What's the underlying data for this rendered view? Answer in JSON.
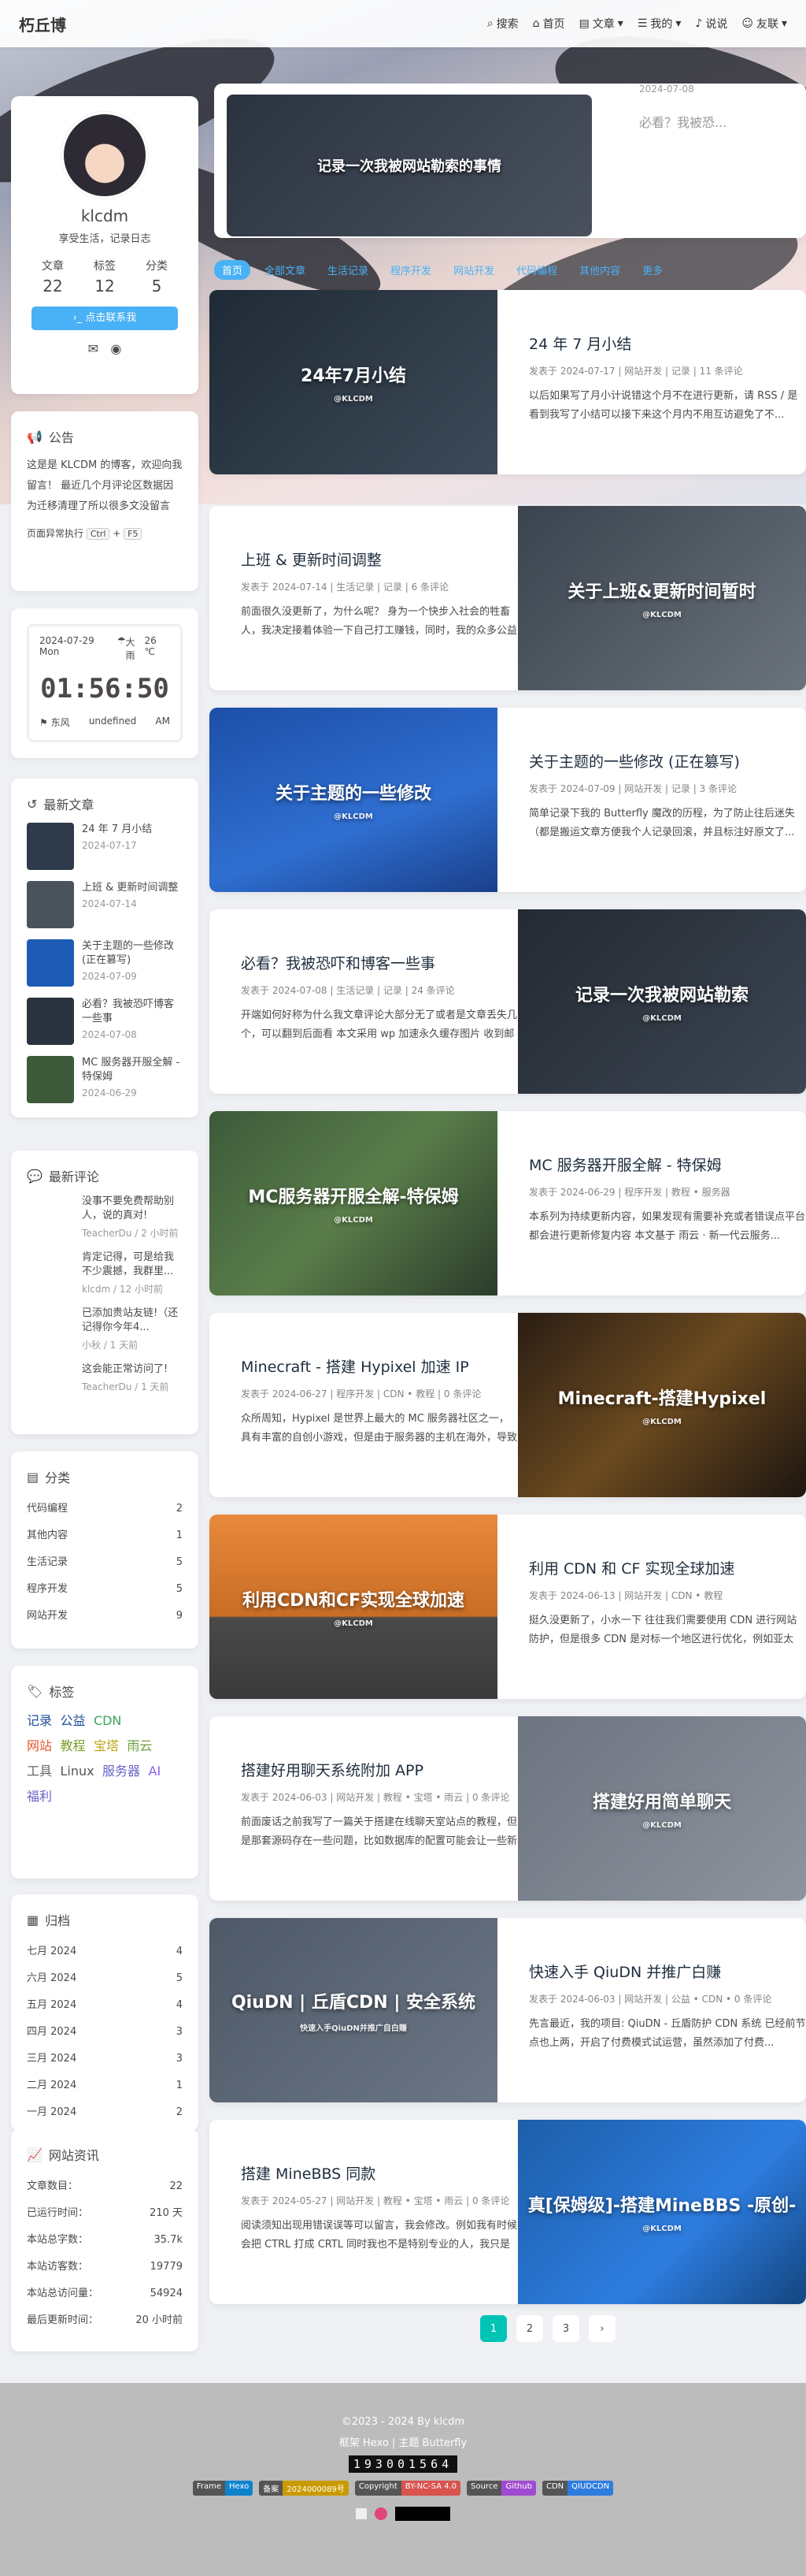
{
  "nav": {
    "brand": "朽丘博",
    "items": [
      "搜索",
      "首页",
      "文章",
      "我的",
      "说说",
      "友联"
    ]
  },
  "featured": {
    "image_title": "记录一次我被网站勒索的事情",
    "date": "2024-07-08",
    "title": "必看？我被恐..."
  },
  "profile": {
    "name": "klcdm",
    "bio": "享受生活，记录日志",
    "stats": [
      {
        "label": "文章",
        "value": "22"
      },
      {
        "label": "标签",
        "value": "12"
      },
      {
        "label": "分类",
        "value": "5"
      }
    ],
    "follow": "点击联系我"
  },
  "announcement": {
    "title": "公告",
    "text": "这是是 KLCDM 的博客，欢迎向我留言！ 最近几个月评论区数据因为迁移清理了所以很多文没留言",
    "shortcut_text": "页面异常执行",
    "key1": "Ctrl",
    "plus": "+",
    "key2": "F5"
  },
  "weather": {
    "date": "2024-07-29 Mon",
    "weather": "大雨",
    "temp": "26 ℃",
    "time": "01:56:50",
    "wind": "东风",
    "extra": "undefined",
    "ampm": "AM"
  },
  "recent": {
    "title": "最新文章",
    "items": [
      {
        "title": "24 年 7 月小结",
        "date": "2024-07-17"
      },
      {
        "title": "上班 & 更新时间调整",
        "date": "2024-07-14"
      },
      {
        "title": "关于主题的一些修改 (正在篡写)",
        "date": "2024-07-09"
      },
      {
        "title": "必看？我被恐吓博客一些事",
        "date": "2024-07-08"
      },
      {
        "title": "MC 服务器开服全解 - 特保姆",
        "date": "2024-06-29"
      }
    ]
  },
  "comments": {
    "title": "最新评论",
    "items": [
      {
        "text": "没事不要免费帮助别人，说的真对!",
        "by": "TeacherDu / 2 小时前"
      },
      {
        "text": "肯定记得，可是给我不少震撼，我群里...",
        "by": "klcdm / 12 小时前"
      },
      {
        "text": "已添加贵站友链!（还记得你今年4...",
        "by": "小秋 / 1 天前"
      },
      {
        "text": "这会能正常访问了!",
        "by": "TeacherDu / 1 天前"
      }
    ]
  },
  "categories": {
    "title": "分类",
    "items": [
      {
        "name": "代码编程",
        "count": "2"
      },
      {
        "name": "其他内容",
        "count": "1"
      },
      {
        "name": "生活记录",
        "count": "5"
      },
      {
        "name": "程序开发",
        "count": "5"
      },
      {
        "name": "网站开发",
        "count": "9"
      }
    ]
  },
  "tags": {
    "title": "标签",
    "items": [
      {
        "name": "记录",
        "color": "#1f4e99"
      },
      {
        "name": "公益",
        "color": "#1f4e99"
      },
      {
        "name": "CDN",
        "color": "#3aa55d"
      },
      {
        "name": "网站",
        "color": "#e0582b"
      },
      {
        "name": "教程",
        "color": "#7f9c2a"
      },
      {
        "name": "宝塔",
        "color": "#c2a319"
      },
      {
        "name": "雨云",
        "color": "#6c9e3a"
      },
      {
        "name": "工具",
        "color": "#666"
      },
      {
        "name": "Linux",
        "color": "#555"
      },
      {
        "name": "服务器",
        "color": "#6a64c9"
      },
      {
        "name": "AI",
        "color": "#8b5cf6"
      },
      {
        "name": "福利",
        "color": "#6a64c9"
      }
    ]
  },
  "archive": {
    "title": "归档",
    "items": [
      {
        "name": "七月 2024",
        "count": "4"
      },
      {
        "name": "六月 2024",
        "count": "5"
      },
      {
        "name": "五月 2024",
        "count": "4"
      },
      {
        "name": "四月 2024",
        "count": "3"
      },
      {
        "name": "三月 2024",
        "count": "3"
      },
      {
        "name": "二月 2024",
        "count": "1"
      },
      {
        "name": "一月 2024",
        "count": "2"
      }
    ]
  },
  "siteinfo": {
    "title": "网站资讯",
    "items": [
      {
        "name": "文章数目：",
        "value": "22"
      },
      {
        "name": "已运行时间：",
        "value": "210 天"
      },
      {
        "name": "本站总字数：",
        "value": "35.7k"
      },
      {
        "name": "本站访客数：",
        "value": "19779"
      },
      {
        "name": "本站总访问量：",
        "value": "54924"
      },
      {
        "name": "最后更新时间：",
        "value": "20 小时前"
      }
    ]
  },
  "tabs": [
    "首页",
    "全部文章",
    "生活记录",
    "程序开发",
    "网站开发",
    "代码编程",
    "其他内容",
    "更多"
  ],
  "posts": [
    {
      "img": "24年7月小结",
      "sub": "@KLCDM",
      "title": "24 年 7 月小结",
      "meta": "发表于 2024-07-17 | 网站开发 | 记录 | 11 条评论",
      "excerpt": "以后如果写了月小计说错这个月不在进行更新，请 RSS / 是看到我写了小结可以接下来这个月内不用互访避免了不..."
    },
    {
      "img": "关于上班&更新时间暂时",
      "sub": "@KLCDM",
      "title": "上班 & 更新时间调整",
      "meta": "发表于 2024-07-14 | 生活记录 | 记录 | 6 条评论",
      "excerpt": "前面很久没更新了，为什么呢？ 身为一个快步入社会的牲畜人，我决定接着体验一下自己打工赚钱，同时，我的众多公益项目，因为急..."
    },
    {
      "img": "关于主题的一些修改",
      "sub": "@KLCDM",
      "title": "关于主题的一些修改 (正在篡写)",
      "meta": "发表于 2024-07-09 | 网站开发 | 记录 | 3 条评论",
      "excerpt": "简单记录下我的 Butterfly 魔改的历程，为了防止往后迷失（都是搬运文章方便我个人记录回滚，并且标注好原文了..."
    },
    {
      "img": "记录一次我被网站勒索",
      "sub": "@KLCDM",
      "title": "必看？我被恐吓和博客一些事",
      "meta": "发表于 2024-07-08 | 生活记录 | 记录 | 24 条评论",
      "excerpt": "开端如何好称为什么我文章评论大部分无了或者是文章丢失几个，可以翻到后面看 本文采用 wp 加速永久缓存图片 收到邮件在一次忙碌..."
    },
    {
      "img": "MC服务器开服全解-特保姆",
      "sub": "@KLCDM",
      "title": "MC 服务器开服全解 - 特保姆",
      "meta": "发表于 2024-06-29 | 程序开发 | 教程 • 服务器",
      "excerpt": "本系列为持续更新内容，如果发现有需要补充或者错误点平台都会进行更新修复内容 本文基于 雨云 · 新一代云服务..."
    },
    {
      "img": "Minecraft-搭建Hypixel",
      "sub": "@KLCDM",
      "title": "Minecraft - 搭建 Hypixel 加速 IP",
      "meta": "发表于 2024-06-27 | 程序开发 | CDN • 教程 | 0 条评论",
      "excerpt": "众所周知，Hypixel 是世界上最大的 MC 服务器社区之一，具有丰富的自创小游戏，但是由于服务器的主机在海外，导致大陆棒速..."
    },
    {
      "img": "利用CDN和CF实现全球加速",
      "sub": "@KLCDM",
      "title": "利用 CDN 和 CF 实现全球加速",
      "meta": "发表于 2024-06-13 | 网站开发 | CDN • 教程",
      "excerpt": "挺久没更新了，小水一下 往往我们需要使用 CDN 进行网站防护，但是很多 CDN 是对标一个地区进行优化，例如亚太 C..."
    },
    {
      "img": "搭建好用简单聊天",
      "sub": "@KLCDM",
      "title": "搭建好用聊天系统附加 APP",
      "meta": "发表于 2024-06-03 | 网站开发 | 教程 • 宝塔 • 雨云 | 0 条评论",
      "excerpt": "前面废话之前我写了一篇关于搭建在线聊天室站点的教程，但是那套源码存在一些问题，比如数据库的配置可能会让一些新手遇到困难..."
    },
    {
      "img": "QiuDN | 丘盾CDN | 安全系统",
      "sub": "快速入手QiuDN并推广自白赚",
      "title": "快速入手 QiuDN 并推广白赚",
      "meta": "发表于 2024-06-03 | 网站开发 | 公益 • CDN • 0 条评论",
      "excerpt": "先言最近，我的项目: QiuDN - 丘盾防护 CDN 系统 已经前节点也上两，开启了付费模式试运营，虽然添加了付费..."
    },
    {
      "img": "真[保姆级]-搭建MineBBS -原创-",
      "sub": "@KLCDM",
      "title": "搭建 MineBBS 同款",
      "meta": "发表于 2024-05-27 | 网站开发 | 教程 • 宝塔 • 雨云 | 0 条评论",
      "excerpt": "阅读须知出现用错误误等可以留言，我会修改。例如我有时候会把 CTRL 打成 CRTL 同时我也不是特别专业的人，我只是把自己的经历..."
    }
  ],
  "pager": [
    "1",
    "2",
    "3",
    "›"
  ],
  "footer": {
    "copyright": "©2023 - 2024 By klcdm",
    "framework": "框架 Hexo | 主题 Butterfly",
    "counter": "193001564",
    "badges": [
      {
        "l": "Frame",
        "r": "Hexo",
        "c": "#0e83cd"
      },
      {
        "l": "备案",
        "r": "2024000089号",
        "c": "#c99a00"
      },
      {
        "l": "Copyright",
        "r": "BY-NC-SA 4.0",
        "c": "#d9534f"
      },
      {
        "l": "Source",
        "r": "Github",
        "c": "#a04ad1"
      },
      {
        "l": "CDN",
        "r": "QIUDCDN",
        "c": "#2d7de0"
      }
    ]
  }
}
